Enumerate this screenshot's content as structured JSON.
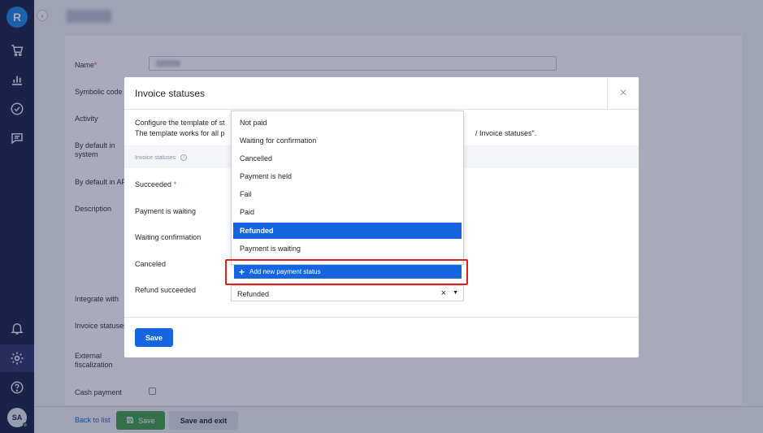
{
  "nav": {
    "logo_letter": "R",
    "icons": [
      "cart-icon",
      "bar-chart-icon",
      "check-circle-icon",
      "chat-icon",
      "bell-icon",
      "gear-icon",
      "help-icon"
    ],
    "avatar_initials": "SA"
  },
  "form": {
    "labels": {
      "name": "Name",
      "symbolic_code": "Symbolic code",
      "activity": "Activity",
      "default_system": "By default in system",
      "default_api": "By default in AP",
      "description": "Description",
      "integrate_with": "Integrate with",
      "invoice_statuses": "Invoice statuses",
      "external_fiscalization": "External fiscalization",
      "cash_payment": "Cash payment"
    },
    "required_mark": "*"
  },
  "footer": {
    "back_link": "Back to list",
    "save": "Save",
    "save_and_exit": "Save and exit"
  },
  "modal": {
    "title": "Invoice statuses",
    "close": "×",
    "desc_line1": "Configure the template of st",
    "desc_line2": "The template works for all p",
    "desc_right": "/ Invoice statuses\".",
    "section_label": "Invoice statuses",
    "rows": {
      "succeeded": "Succeeded",
      "payment_waiting": "Payment is waiting",
      "waiting_confirmation": "Waiting confirmation",
      "canceled": "Canceled",
      "refund_succeeded": "Refund succeeded"
    },
    "save": "Save"
  },
  "dropdown": {
    "options": [
      "Not paid",
      "Waiting for confirmation",
      "Cancelled",
      "Payment is held",
      "Fail",
      "Paid",
      "Refunded",
      "Payment is waiting"
    ],
    "selected": "Refunded",
    "add_new": "Add new payment status"
  },
  "select": {
    "value": "Refunded",
    "clear": "×",
    "caret": "▼"
  },
  "colors": {
    "nav_bg": "#1b2347",
    "accent": "#1565e0",
    "highlight_frame": "#e0201e",
    "save_green": "#43a047"
  }
}
